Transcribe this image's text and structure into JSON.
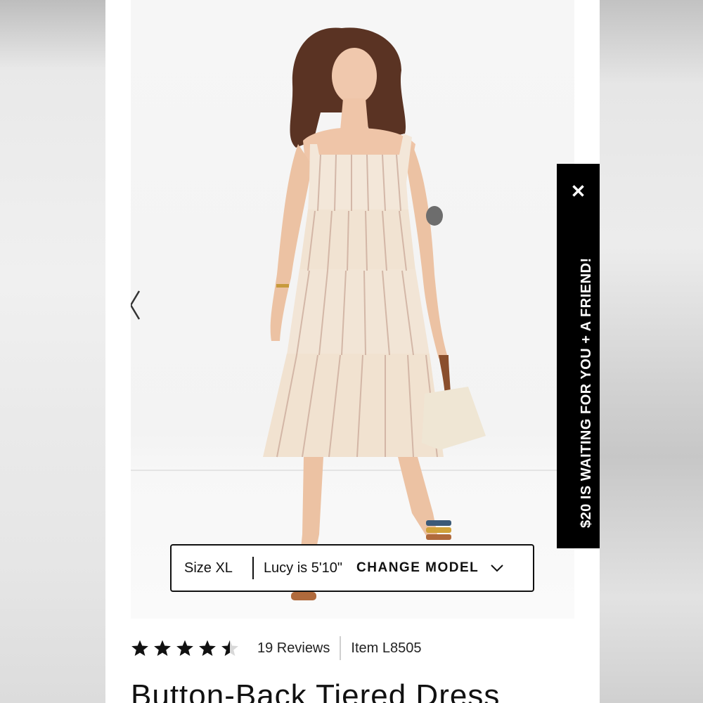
{
  "size_bar": {
    "size": "Size XL",
    "model": "Lucy is 5'10\"",
    "change": "CHANGE MODEL"
  },
  "promo": {
    "text": "$20 IS WAITING FOR YOU + A FRIEND!",
    "close": "✕"
  },
  "product": {
    "rating": 4.5,
    "reviews": "19 Reviews",
    "item": "Item L8505",
    "title": "Button-Back Tiered Dress"
  },
  "icons": {
    "prev": "chevron-left-icon",
    "dropdown": "chevron-down-icon",
    "star": "star-icon"
  }
}
